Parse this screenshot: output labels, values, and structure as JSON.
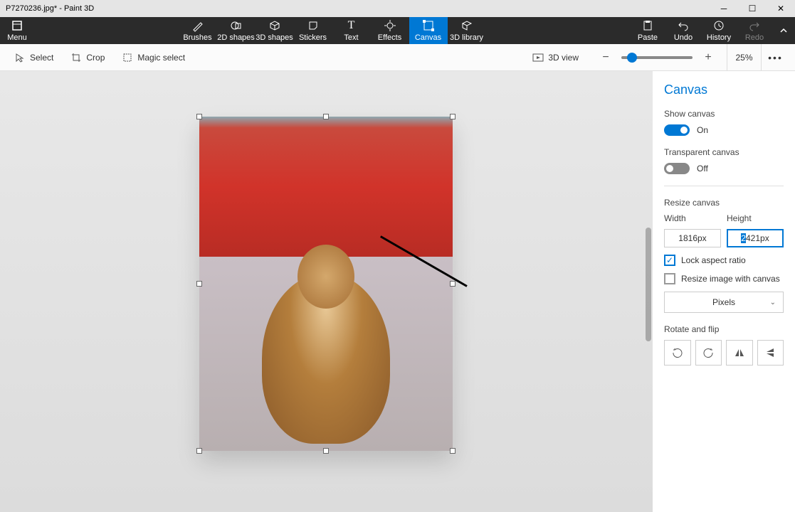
{
  "title": "P7270236.jpg* - Paint 3D",
  "menu_label": "Menu",
  "ribbon": {
    "brushes": "Brushes",
    "shapes2d": "2D shapes",
    "shapes3d": "3D shapes",
    "stickers": "Stickers",
    "text": "Text",
    "effects": "Effects",
    "canvas": "Canvas",
    "library3d": "3D library",
    "paste": "Paste",
    "undo": "Undo",
    "history": "History",
    "redo": "Redo"
  },
  "toolbar": {
    "select": "Select",
    "crop": "Crop",
    "magic_select": "Magic select",
    "view3d": "3D view",
    "zoom_pct": "25%"
  },
  "panel": {
    "title": "Canvas",
    "show_canvas": "Show canvas",
    "on": "On",
    "transparent_canvas": "Transparent canvas",
    "off": "Off",
    "resize_canvas": "Resize canvas",
    "width_label": "Width",
    "height_label": "Height",
    "width_value": "1816",
    "height_value": "2421",
    "px": "px",
    "lock_aspect": "Lock aspect ratio",
    "resize_image": "Resize image with canvas",
    "units": "Pixels",
    "rotate_flip": "Rotate and flip"
  }
}
